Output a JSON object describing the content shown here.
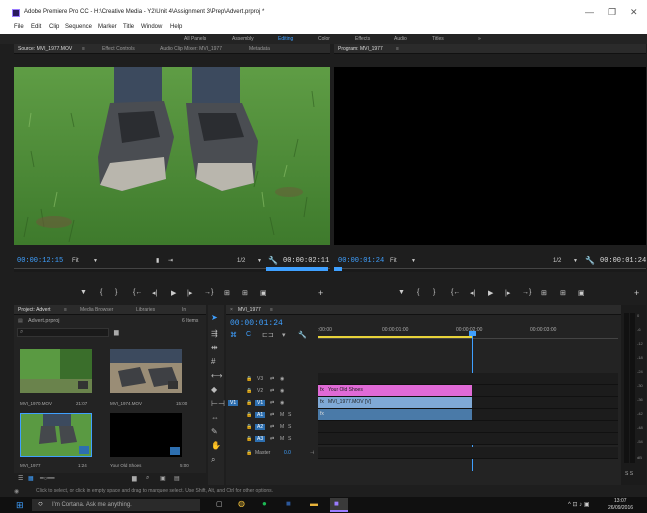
{
  "window": {
    "title": "Adobe Premiere Pro CC - H:\\Creative Media - Y2\\Unit 4\\Assignment 3\\Prep\\Advert.prproj *",
    "minimize": "—",
    "maximize": "❐",
    "close": "✕"
  },
  "menu": [
    "File",
    "Edit",
    "Clip",
    "Sequence",
    "Marker",
    "Title",
    "Window",
    "Help"
  ],
  "workspaces": {
    "items": [
      "All Panels",
      "Assembly",
      "Editing",
      "Color",
      "Effects",
      "Audio",
      "Titles"
    ],
    "active": "Editing",
    "active_color": "#3fa0ff",
    "more": "»"
  },
  "source": {
    "tab": "Source: MVI_1977.MOV",
    "tab_menu": "≡",
    "other_tabs": [
      "Effect Controls",
      "Audio Clip Mixer: MVI_1977",
      "Metadata"
    ],
    "timecode": "00:00:12:15",
    "fit": "Fit",
    "fraction": "1/2",
    "duration": "00:00:02:11"
  },
  "program": {
    "tab": "Program: MVI_1977",
    "tab_menu": "≡",
    "timecode": "00:00:01:24",
    "fit": "Fit",
    "fraction": "1/2",
    "duration": "00:00:01:24"
  },
  "transport_glyphs": [
    "▼",
    "{",
    "}",
    "{←",
    "◂|",
    "▶",
    "|▸",
    "→}",
    "⊞",
    "⊞",
    "▣"
  ],
  "add_glyph": "+",
  "project": {
    "tab": "Project: Advert",
    "tab_menu": "≡",
    "other_tabs": [
      "Media Browser",
      "Libraries",
      "In"
    ],
    "file": "Advert.prproj",
    "items_count": "6 Items",
    "search_glyph": "⌕",
    "items": [
      {
        "name": "MVI_1970.MOV",
        "dur": "21:07"
      },
      {
        "name": "MVI_1974.MOV",
        "dur": "15:00"
      },
      {
        "name": "MVI_1977",
        "dur": "1:24"
      },
      {
        "name": "Your Old Shoes",
        "dur": "5:00"
      }
    ]
  },
  "timeline": {
    "tab": "MVI_1977",
    "tab_menu": "≡",
    "close": "×",
    "timecode": "00:00:01:24",
    "ruler": [
      ":00:00",
      "00:00:01:00",
      "00:00:02:00",
      "00:00:03:00"
    ],
    "tracks": [
      {
        "name": "V3",
        "kind": "video"
      },
      {
        "name": "V2",
        "kind": "video"
      },
      {
        "name": "V1",
        "kind": "video",
        "target": "V1"
      },
      {
        "name": "A1",
        "kind": "audio"
      },
      {
        "name": "A2",
        "kind": "audio"
      },
      {
        "name": "A3",
        "kind": "audio"
      }
    ],
    "master": "Master",
    "master_value": "0.0",
    "clips": {
      "v2": "Your Old Shoes",
      "v1": "MVI_1977.MOV [V]",
      "fx": "fx"
    },
    "clip_colors": {
      "title": "#e06ad6",
      "video": "#7fa9d6",
      "audio": "#4a7aa8"
    }
  },
  "meters": [
    "0",
    "-6",
    "-12",
    "-18",
    "-24",
    "-30",
    "-36",
    "-42",
    "-48",
    "-54",
    "dB"
  ],
  "meter_buttons": "S S",
  "status": "Click to select, or click in empty space and drag to marquee select. Use Shift, Alt, and Ctrl for other options.",
  "taskbar": {
    "cortana": "I'm Cortana. Ask me anything.",
    "time": "13:07",
    "date": "26/09/2016"
  }
}
